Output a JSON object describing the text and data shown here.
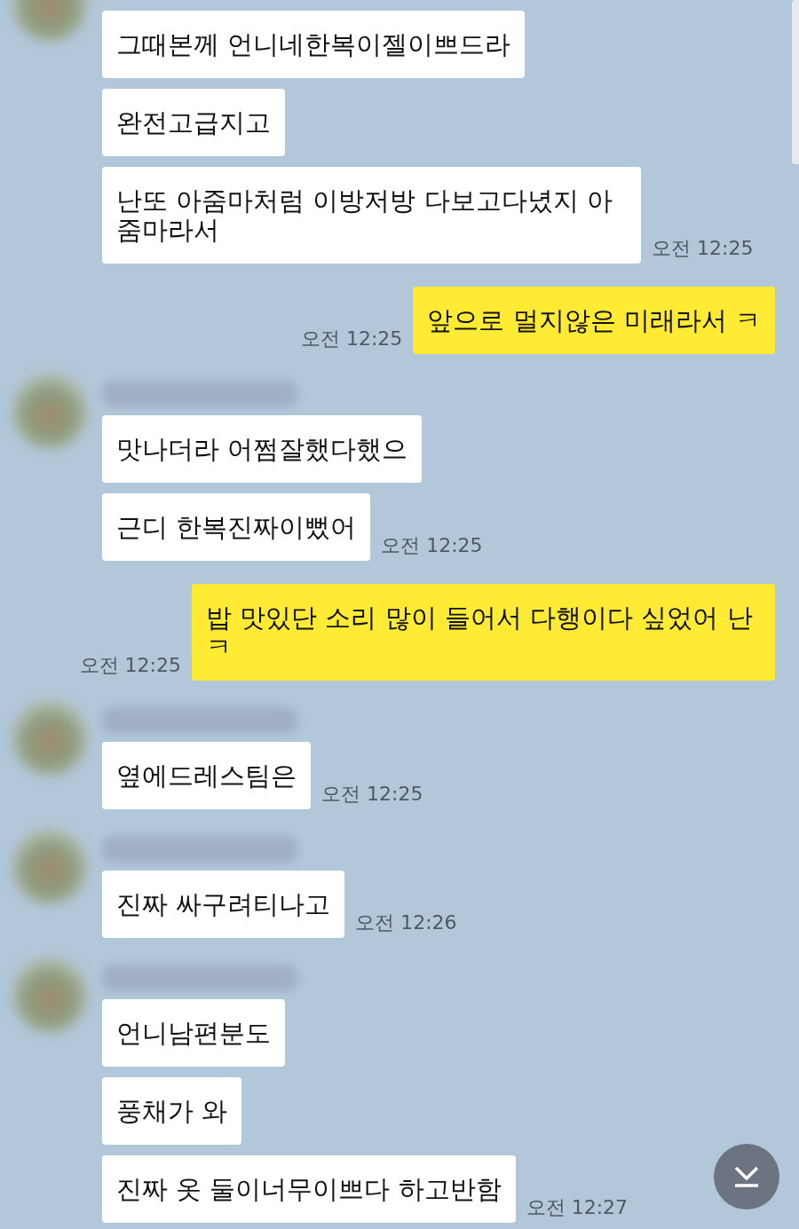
{
  "groups": [
    {
      "kind": "cut",
      "messages": [
        {
          "text": "그때본께 언니네한복이젤이쁘드라"
        },
        {
          "text": "완전고급지고"
        },
        {
          "text": "난또 아줌마처럼 이방저방 다보고다녔지 아줌마라서"
        }
      ],
      "time": "오전 12:25"
    },
    {
      "kind": "sent",
      "messages": [
        {
          "text": "앞으로 멀지않은 미래라서 ㅋ"
        }
      ],
      "time": "오전 12:25"
    },
    {
      "kind": "received",
      "messages": [
        {
          "text": "맛나더라 어쩜잘했다했으"
        },
        {
          "text": "근디 한복진짜이뻤어"
        }
      ],
      "time": "오전 12:25"
    },
    {
      "kind": "sent",
      "messages": [
        {
          "text": "밥 맛있단 소리 많이 들어서 다행이다 싶었어 난 ㅋ"
        }
      ],
      "time": "오전 12:25"
    },
    {
      "kind": "received",
      "messages": [
        {
          "text": "옆에드레스팀은"
        }
      ],
      "time": "오전 12:25"
    },
    {
      "kind": "received",
      "messages": [
        {
          "text": "진짜 싸구려티나고"
        }
      ],
      "time": "오전 12:26"
    },
    {
      "kind": "received",
      "messages": [
        {
          "text": "언니남편분도"
        },
        {
          "text": "풍채가 와"
        },
        {
          "text": "진짜 옷 둘이너무이쁘다 하고반함"
        }
      ],
      "time": "오전 12:27"
    }
  ]
}
